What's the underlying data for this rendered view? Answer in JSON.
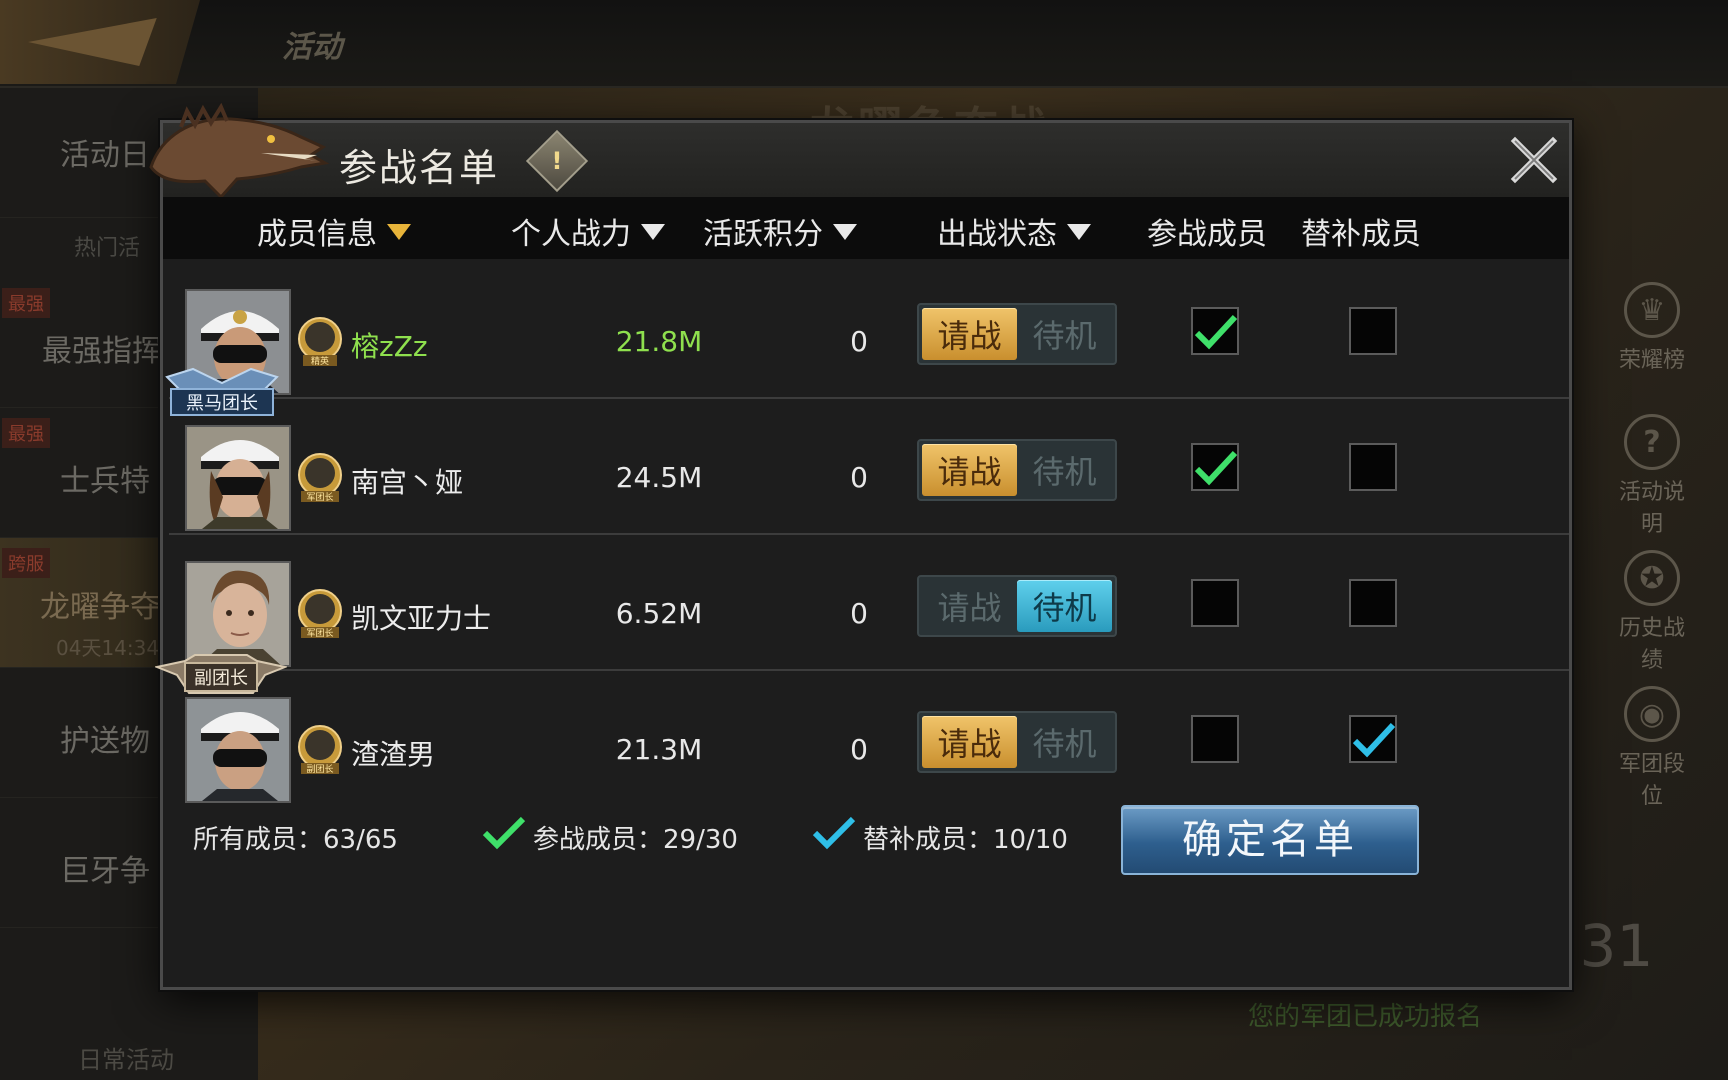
{
  "background": {
    "tab_title": "活动",
    "banner_title": "龙曜争夺战",
    "sidebar": [
      {
        "tag": "",
        "label": "活动日",
        "sub": "热门活"
      },
      {
        "tag": "最强",
        "label": "最强指挥",
        "sub": ""
      },
      {
        "tag": "最强",
        "label": "士兵特",
        "sub": ""
      },
      {
        "tag": "跨服",
        "label": "龙曜争夺",
        "sub": "04天14:34"
      },
      {
        "tag": "",
        "label": "护送物",
        "sub": ""
      },
      {
        "tag": "",
        "label": "巨牙争",
        "sub": ""
      }
    ],
    "daily_label": "日常活动",
    "right_icons": [
      {
        "label": "荣耀榜",
        "icon": "trophy-icon"
      },
      {
        "label": "活动说明",
        "icon": "question-icon"
      },
      {
        "label": "历史战绩",
        "icon": "laurel-icon"
      },
      {
        "label": "军团段位",
        "icon": "medal-icon"
      }
    ],
    "big_timer": ":31",
    "registered_text": "您的军团已成功报名"
  },
  "modal": {
    "title": "参战名单",
    "info_icon": "!",
    "columns": {
      "member_info": "成员信息",
      "personal_power": "个人战力",
      "activity_points": "活跃积分",
      "battle_status": "出战状态",
      "participant": "参战成员",
      "substitute": "替补成员"
    },
    "toggle_labels": {
      "fight": "请战",
      "standby": "待机"
    },
    "rows": [
      {
        "name": "榕zZz",
        "rank": "精英",
        "power": "21.8M",
        "activity": "0",
        "status": "fight",
        "participant": true,
        "substitute": false,
        "crest": "黑马团长",
        "name_color": "#8fe04e",
        "power_color": "#8fe04e"
      },
      {
        "name": "南宫丶娅",
        "rank": "军团长",
        "power": "24.5M",
        "activity": "0",
        "status": "fight",
        "participant": true,
        "substitute": false,
        "crest": "",
        "name_color": "#ececec",
        "power_color": "#ececec"
      },
      {
        "name": "凯文亚力士",
        "rank": "军团长",
        "power": "6.52M",
        "activity": "0",
        "status": "standby",
        "participant": false,
        "substitute": false,
        "crest": "副团长",
        "name_color": "#ececec",
        "power_color": "#ececec"
      },
      {
        "name": "渣渣男",
        "rank": "副团长",
        "power": "21.3M",
        "activity": "0",
        "status": "fight",
        "participant": false,
        "substitute": true,
        "crest": "",
        "name_color": "#ececec",
        "power_color": "#ececec"
      }
    ],
    "footer": {
      "all_members": "所有成员：63/65",
      "participants": "参战成员：29/30",
      "substitutes": "替补成员：10/10"
    },
    "confirm_label": "确定名单",
    "colors": {
      "check_green": "#3fe06a",
      "check_blue": "#2fbfe8",
      "fight_gold": "#e3a848",
      "standby_blue": "#3bb4d6"
    }
  }
}
